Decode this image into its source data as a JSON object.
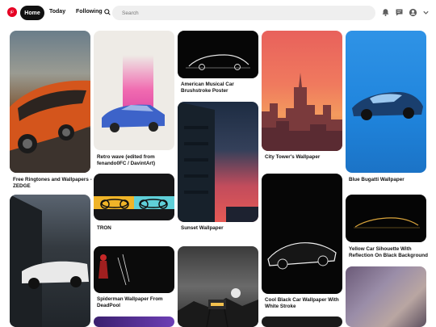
{
  "header": {
    "nav": {
      "home": "Home",
      "today": "Today",
      "following": "Following"
    },
    "search_placeholder": "Search",
    "icons": [
      "pinterest-logo-icon",
      "chevron-down-icon",
      "bell-icon",
      "message-icon",
      "profile-icon",
      "chevron-down-icon"
    ]
  },
  "colors": {
    "brand": "#e60023",
    "active_tab": "#111111",
    "search_bg": "#efefef"
  },
  "pins": [
    {
      "caption": "Free Ringtones and Wallpapers - ZEDGE"
    },
    {
      "caption": ""
    },
    {
      "caption": "Retro wave (edited from fenando0FC / DavintArt)"
    },
    {
      "caption": "TRON"
    },
    {
      "caption": "Spiderman Wallpaper From DeadPool"
    },
    {
      "caption": ""
    },
    {
      "caption": "American Musical Car Brushstroke Poster"
    },
    {
      "caption": "Sunset Wallpaper"
    },
    {
      "caption": ""
    },
    {
      "caption": "City Tower's Wallpaper"
    },
    {
      "caption": "Cool Black Car Wallpaper With White Stroke"
    },
    {
      "caption": ""
    },
    {
      "caption": "Blue Bugatti Wallpaper"
    },
    {
      "caption": "Yellow Car Sihouette With Reflection On Black Background"
    },
    {
      "caption": ""
    }
  ]
}
